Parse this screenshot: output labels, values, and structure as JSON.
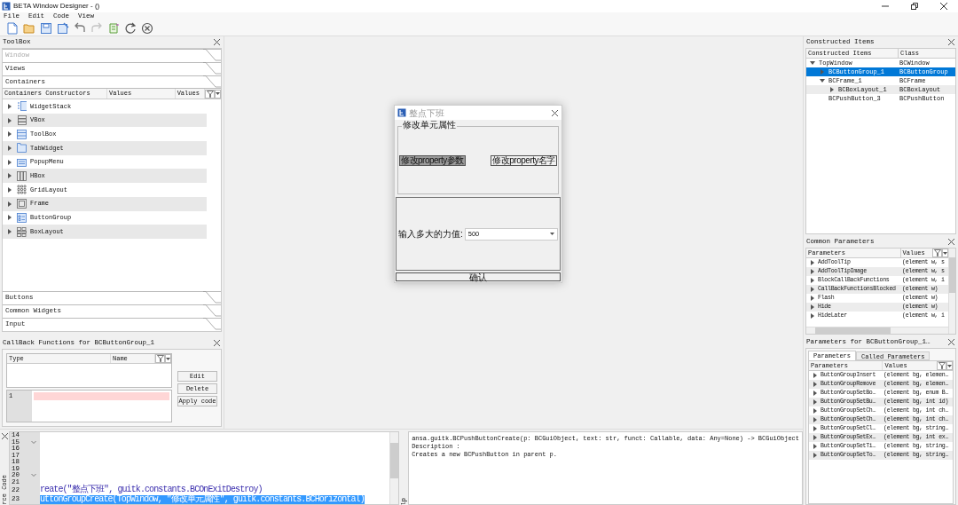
{
  "window": {
    "title": "BETA Window Designer - ()"
  },
  "menu": [
    "File",
    "Edit",
    "Code",
    "View"
  ],
  "toolbar": [
    {
      "kind": "new",
      "disabled": false
    },
    {
      "kind": "open",
      "disabled": false
    },
    {
      "kind": "save",
      "disabled": false
    },
    {
      "kind": "save_as",
      "disabled": false
    },
    {
      "kind": "undo",
      "disabled": false
    },
    {
      "kind": "redo",
      "disabled": true
    },
    {
      "kind": "script",
      "disabled": false
    },
    {
      "kind": "refresh",
      "disabled": false
    },
    {
      "kind": "cancel",
      "disabled": false
    }
  ],
  "toolbox": {
    "title": "ToolBox",
    "sections": [
      {
        "label": "Window",
        "disabled": true,
        "expanded": false
      },
      {
        "label": "Views",
        "disabled": false,
        "expanded": false
      },
      {
        "label": "Containers",
        "disabled": false,
        "expanded": true
      },
      {
        "label": "Buttons",
        "disabled": false,
        "expanded": false
      },
      {
        "label": "Common Widgets",
        "disabled": false,
        "expanded": false
      },
      {
        "label": "Input",
        "disabled": false,
        "expanded": false
      }
    ],
    "columns": [
      "Containers Constructors",
      "Values",
      "Values"
    ],
    "rows": [
      {
        "label": "WidgetStack",
        "kind": "stack"
      },
      {
        "label": "VBox",
        "kind": "vbox"
      },
      {
        "label": "ToolBox",
        "kind": "toolbox"
      },
      {
        "label": "TabWidget",
        "kind": "tabs"
      },
      {
        "label": "PopupMenu",
        "kind": "menu"
      },
      {
        "label": "HBox",
        "kind": "hbox"
      },
      {
        "label": "GridLayout",
        "kind": "grid"
      },
      {
        "label": "Frame",
        "kind": "frame"
      },
      {
        "label": "ButtonGroup",
        "kind": "buttongroup"
      },
      {
        "label": "BoxLayout",
        "kind": "boxlayout"
      }
    ]
  },
  "callbacks": {
    "title": "CallBack Functions for BCButtonGroup_1",
    "columns": [
      "Type",
      "Name"
    ],
    "editor_lines": [
      {
        "number": "1",
        "error": true
      }
    ],
    "buttons": [
      "Edit",
      "Delete",
      "Apply code"
    ]
  },
  "designer_dialog": {
    "title": "整点下班",
    "group_title": "修改单元属性",
    "group_buttons": [
      {
        "label": "修改property参数",
        "checked": true
      },
      {
        "label": "修改property名字",
        "checked": false
      }
    ],
    "field_label": "输入多大的力值:",
    "combo_value": "500",
    "confirm": "确认"
  },
  "constructed_items": {
    "title": "Constructed Items",
    "columns": [
      "Constructed Items",
      "Class"
    ],
    "tree": [
      {
        "name": "TopWindow",
        "class": "BCWindow",
        "kind": "branch",
        "expanded": true,
        "selected": false,
        "children": [
          {
            "name": "BCButtonGroup_1",
            "class": "BCButtonGroup",
            "kind": "branch",
            "expanded": false,
            "selected": true
          },
          {
            "name": "BCFrame_1",
            "class": "BCFrame",
            "kind": "branch",
            "expanded": true,
            "selected": false,
            "children": [
              {
                "name": "BCBoxLayout_1",
                "class": "BCBoxLayout",
                "kind": "branch",
                "expanded": false,
                "selected": false
              }
            ]
          },
          {
            "name": "BCPushButton_3",
            "class": "BCPushButton",
            "kind": "leaf",
            "selected": false
          }
        ]
      }
    ]
  },
  "common_parameters": {
    "title": "Common Parameters",
    "columns": [
      "Parameters",
      "Values"
    ],
    "rows": [
      {
        "name": "AddToolTip",
        "value": "(element w, s"
      },
      {
        "name": "AddToolTipImage",
        "value": "(element w, s"
      },
      {
        "name": "BlockCallBackFunctions",
        "value": "(element w, i"
      },
      {
        "name": "CallBackFunctionsBlocked",
        "value": "(element w)"
      },
      {
        "name": "Flash",
        "value": "(element w)"
      },
      {
        "name": "Hide",
        "value": "(element w)"
      },
      {
        "name": "HideLater",
        "value": "(element w, i"
      }
    ]
  },
  "parameters_panel": {
    "title": "Parameters for BCButtonGroup_1…",
    "tabs": [
      {
        "label": "Parameters",
        "selected": true
      },
      {
        "label": "Called Parameters",
        "selected": false
      }
    ],
    "columns": [
      "Parameters",
      "Values"
    ],
    "rows": [
      {
        "name": "ButtonGroupInsert",
        "value": "(element bg, elemen…"
      },
      {
        "name": "ButtonGroupRemove",
        "value": "(element bg, elemen…"
      },
      {
        "name": "ButtonGroupSetBo…",
        "value": "(element bg, enum B…"
      },
      {
        "name": "ButtonGroupSetBu…",
        "value": "(element bg, int id)"
      },
      {
        "name": "ButtonGroupSetCh…",
        "value": "(element bg, int ch…"
      },
      {
        "name": "ButtonGroupSetCh…",
        "value": "(element bg, int ch…"
      },
      {
        "name": "ButtonGroupSetCl…",
        "value": "(element bg, string…"
      },
      {
        "name": "ButtonGroupSetEx…",
        "value": "(element bg, int ex…"
      },
      {
        "name": "ButtonGroupSetTi…",
        "value": "(element bg, string…"
      },
      {
        "name": "ButtonGroupSetTo…",
        "value": "(element bg, string…"
      }
    ]
  },
  "source_code": {
    "tab_label": "rce Code",
    "lines": [
      {
        "number": "14",
        "foldable": false,
        "selected": false
      },
      {
        "number": "15",
        "foldable": true,
        "selected": false
      },
      {
        "number": "16",
        "foldable": false,
        "selected": false
      },
      {
        "number": "17",
        "foldable": false,
        "selected": false
      },
      {
        "number": "18",
        "foldable": false,
        "selected": false
      },
      {
        "number": "19",
        "foldable": false,
        "selected": false
      },
      {
        "number": "20",
        "foldable": true,
        "selected": false
      },
      {
        "number": "21",
        "foldable": false,
        "selected": false
      },
      {
        "number": "22",
        "foldable": false,
        "selected": false,
        "text": "reate(\"整点下班\", guitk.constants.BCOnExitDestroy)"
      },
      {
        "number": "23",
        "foldable": false,
        "selected": true,
        "text": "uttonGroupCreate(TopWindow, \"修改单元属性\", guitk.constants.BCHorizontal)"
      }
    ]
  },
  "documentation": {
    "tab_label": "lp",
    "lines": [
      "ansa.guitk.BCPushButtonCreate(p: BCGuiObject, text: str, funct: Callable, data: Any=None) -> BCGuiObject",
      "Description :",
      "Creates a new BCPushButton in parent p."
    ]
  }
}
